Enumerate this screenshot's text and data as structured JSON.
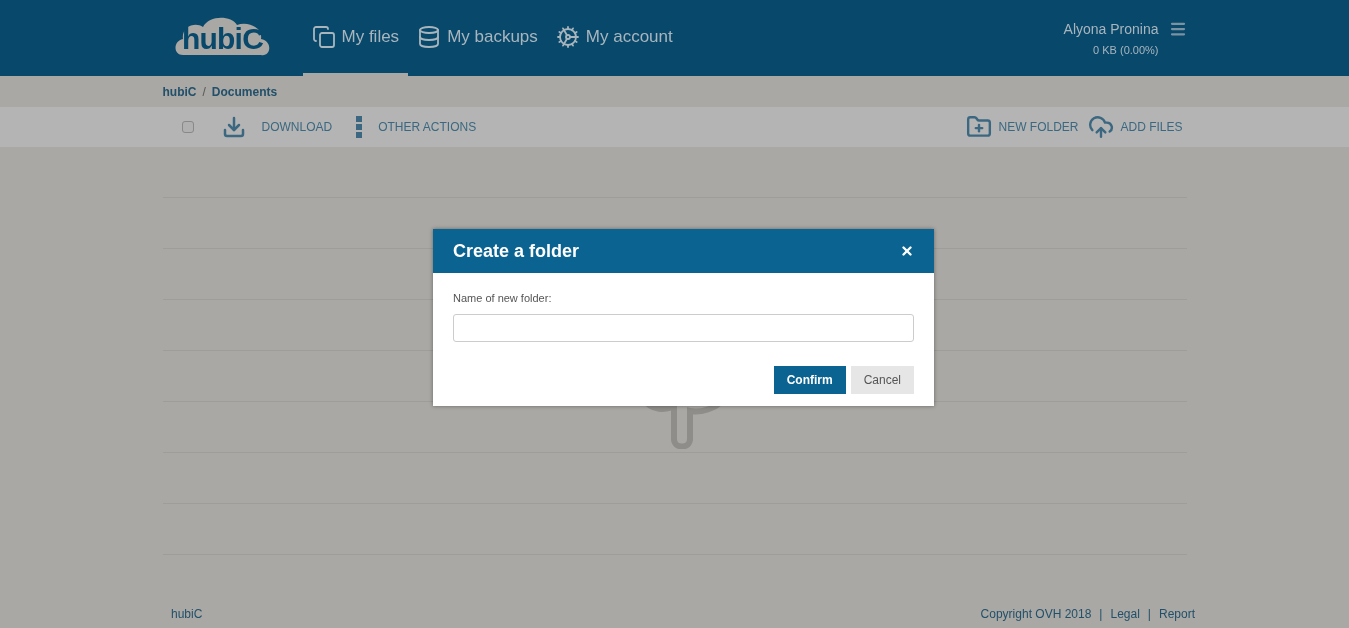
{
  "header": {
    "logo": "hubiC",
    "nav": [
      {
        "label": "My files",
        "selected": true
      },
      {
        "label": "My backups",
        "selected": false
      },
      {
        "label": "My account",
        "selected": false
      }
    ],
    "user": {
      "name": "Alyona Pronina",
      "quota": "0 KB (0.00%)"
    }
  },
  "breadcrumb": [
    "hubiC",
    "/",
    "Documents"
  ],
  "toolbar": {
    "select_all": {
      "checked": false
    },
    "left_actions": [
      {
        "label": "DOWNLOAD"
      },
      {
        "label": "OTHER ACTIONS"
      }
    ],
    "right_actions": [
      {
        "label": "NEW FOLDER"
      },
      {
        "label": "ADD FILES"
      }
    ]
  },
  "dialog": {
    "title": "Create a folder",
    "field_label": "Name of new folder:",
    "buttons": [
      {
        "label": "Confirm",
        "kind": "primary"
      },
      {
        "label": "Cancel",
        "kind": "secondary"
      }
    ]
  },
  "footer": {
    "brand": "hubiC",
    "items": [
      "Copyright OVH 2018",
      "|",
      "Legal",
      "|",
      "Report"
    ]
  }
}
